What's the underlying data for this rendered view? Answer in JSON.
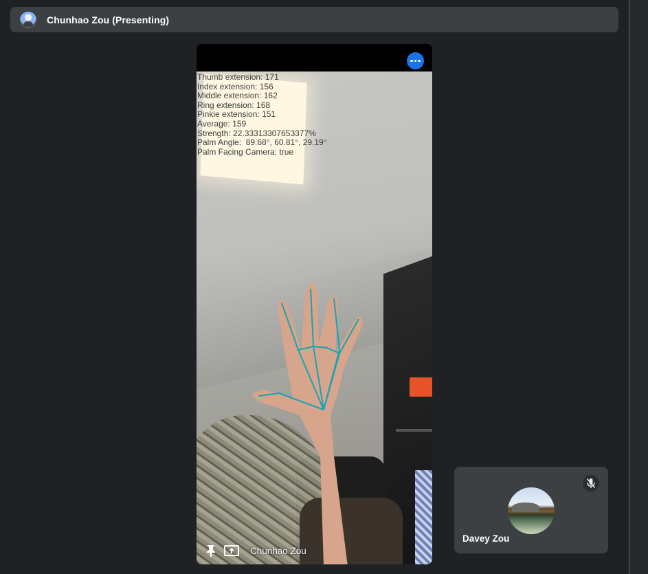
{
  "banner": {
    "presenter_label": "Chunhao Zou (Presenting)",
    "avatar_icon": "user-avatar-icon"
  },
  "main_video": {
    "participant_name": "Chunhao Zou",
    "more_options_icon": "more-options-icon",
    "pin_icon": "pin-icon",
    "presenting_icon": "present-screen-icon",
    "overlay_lines": [
      "Thumb extension: 171",
      "Index extension: 156",
      "Middle extension: 162",
      "Ring extension: 168",
      "Pinkie extension: 151",
      "Average: 159",
      "Strength: 22.33313307653377%",
      "Palm Angle:  89.68°, 60.81°, 29.19°",
      "Palm Facing Camera: true"
    ],
    "skeleton_color": "#16a3b5"
  },
  "participant_tile": {
    "name": "Davey Zou",
    "mic_status_icon": "mic-off-icon"
  },
  "colors": {
    "background": "#202124",
    "surface": "#3c4043",
    "accent": "#1a73e8"
  }
}
